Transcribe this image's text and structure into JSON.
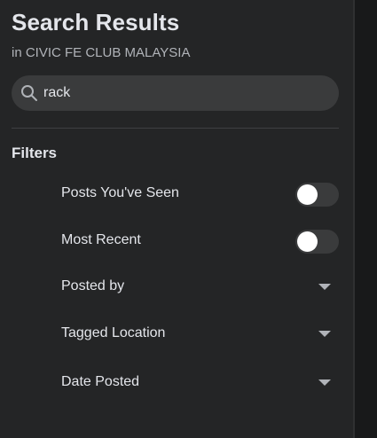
{
  "header": {
    "title": "Search Results",
    "subtitle": "in CIVIC FE CLUB MALAYSIA"
  },
  "search": {
    "value": "rack",
    "icon": "search-icon"
  },
  "filters": {
    "heading": "Filters",
    "items": [
      {
        "label": "Posts You've Seen",
        "control": "toggle",
        "on": false
      },
      {
        "label": "Most Recent",
        "control": "toggle",
        "on": false
      },
      {
        "label": "Posted by",
        "control": "dropdown"
      },
      {
        "label": "Tagged Location",
        "control": "dropdown"
      },
      {
        "label": "Date Posted",
        "control": "dropdown"
      }
    ]
  },
  "colors": {
    "panel_bg": "#242526",
    "page_bg": "#18191a",
    "text_primary": "#e4e6eb",
    "text_secondary": "#b0b3b8",
    "input_bg": "#3a3b3c"
  }
}
